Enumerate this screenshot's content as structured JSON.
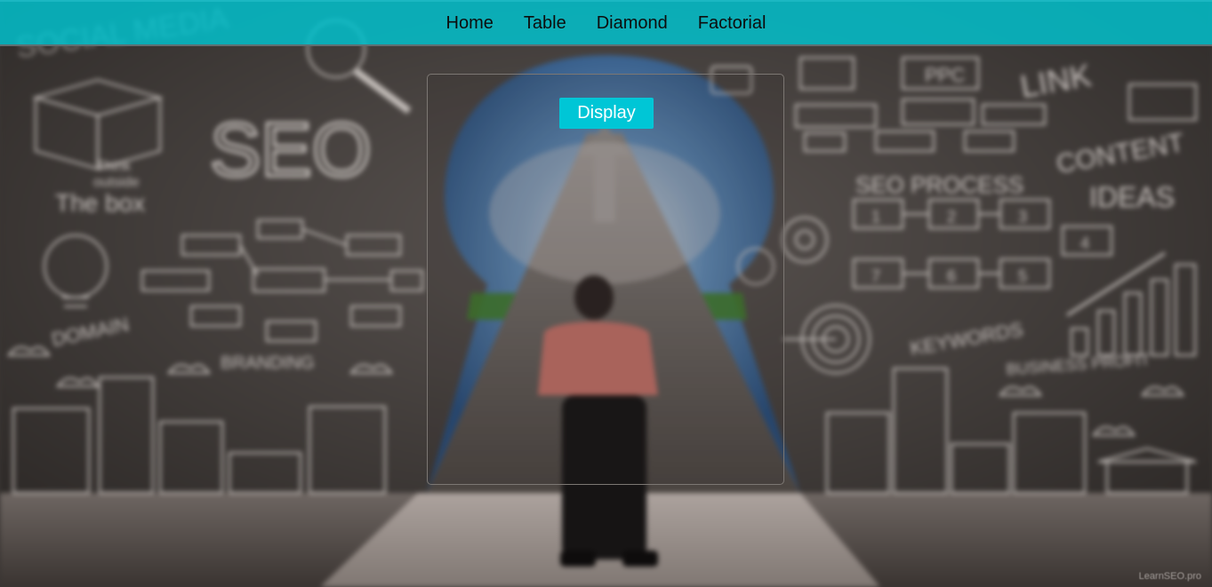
{
  "nav": {
    "items": [
      {
        "label": "Home"
      },
      {
        "label": "Table"
      },
      {
        "label": "Diamond"
      },
      {
        "label": "Factorial"
      }
    ]
  },
  "card": {
    "button_label": "Display"
  },
  "background": {
    "texts": {
      "social_media": "SOCIAL MEDIA",
      "seo": "SEO",
      "think": "Think",
      "outside": "outside",
      "the_box": "The box",
      "domain": "DOMAIN",
      "branding": "BRANDING",
      "link": "LINK",
      "content": "CONTENT",
      "ideas": "IDEAS",
      "seo_process": "SEO PROCESS",
      "keywords": "KEYWORDS",
      "business_profit": "BUSINESS PROFIT",
      "ppc": "PPC",
      "step1": "1",
      "step2": "2",
      "step3": "3",
      "step4": "4",
      "step5": "5",
      "step6": "6",
      "step7": "7"
    },
    "watermark": "LearnSEO.pro"
  },
  "colors": {
    "navbar": "#00c6d2",
    "button": "#00c6d6",
    "chalkboard": "#3a3634",
    "chalk": "#d8d2ce"
  }
}
